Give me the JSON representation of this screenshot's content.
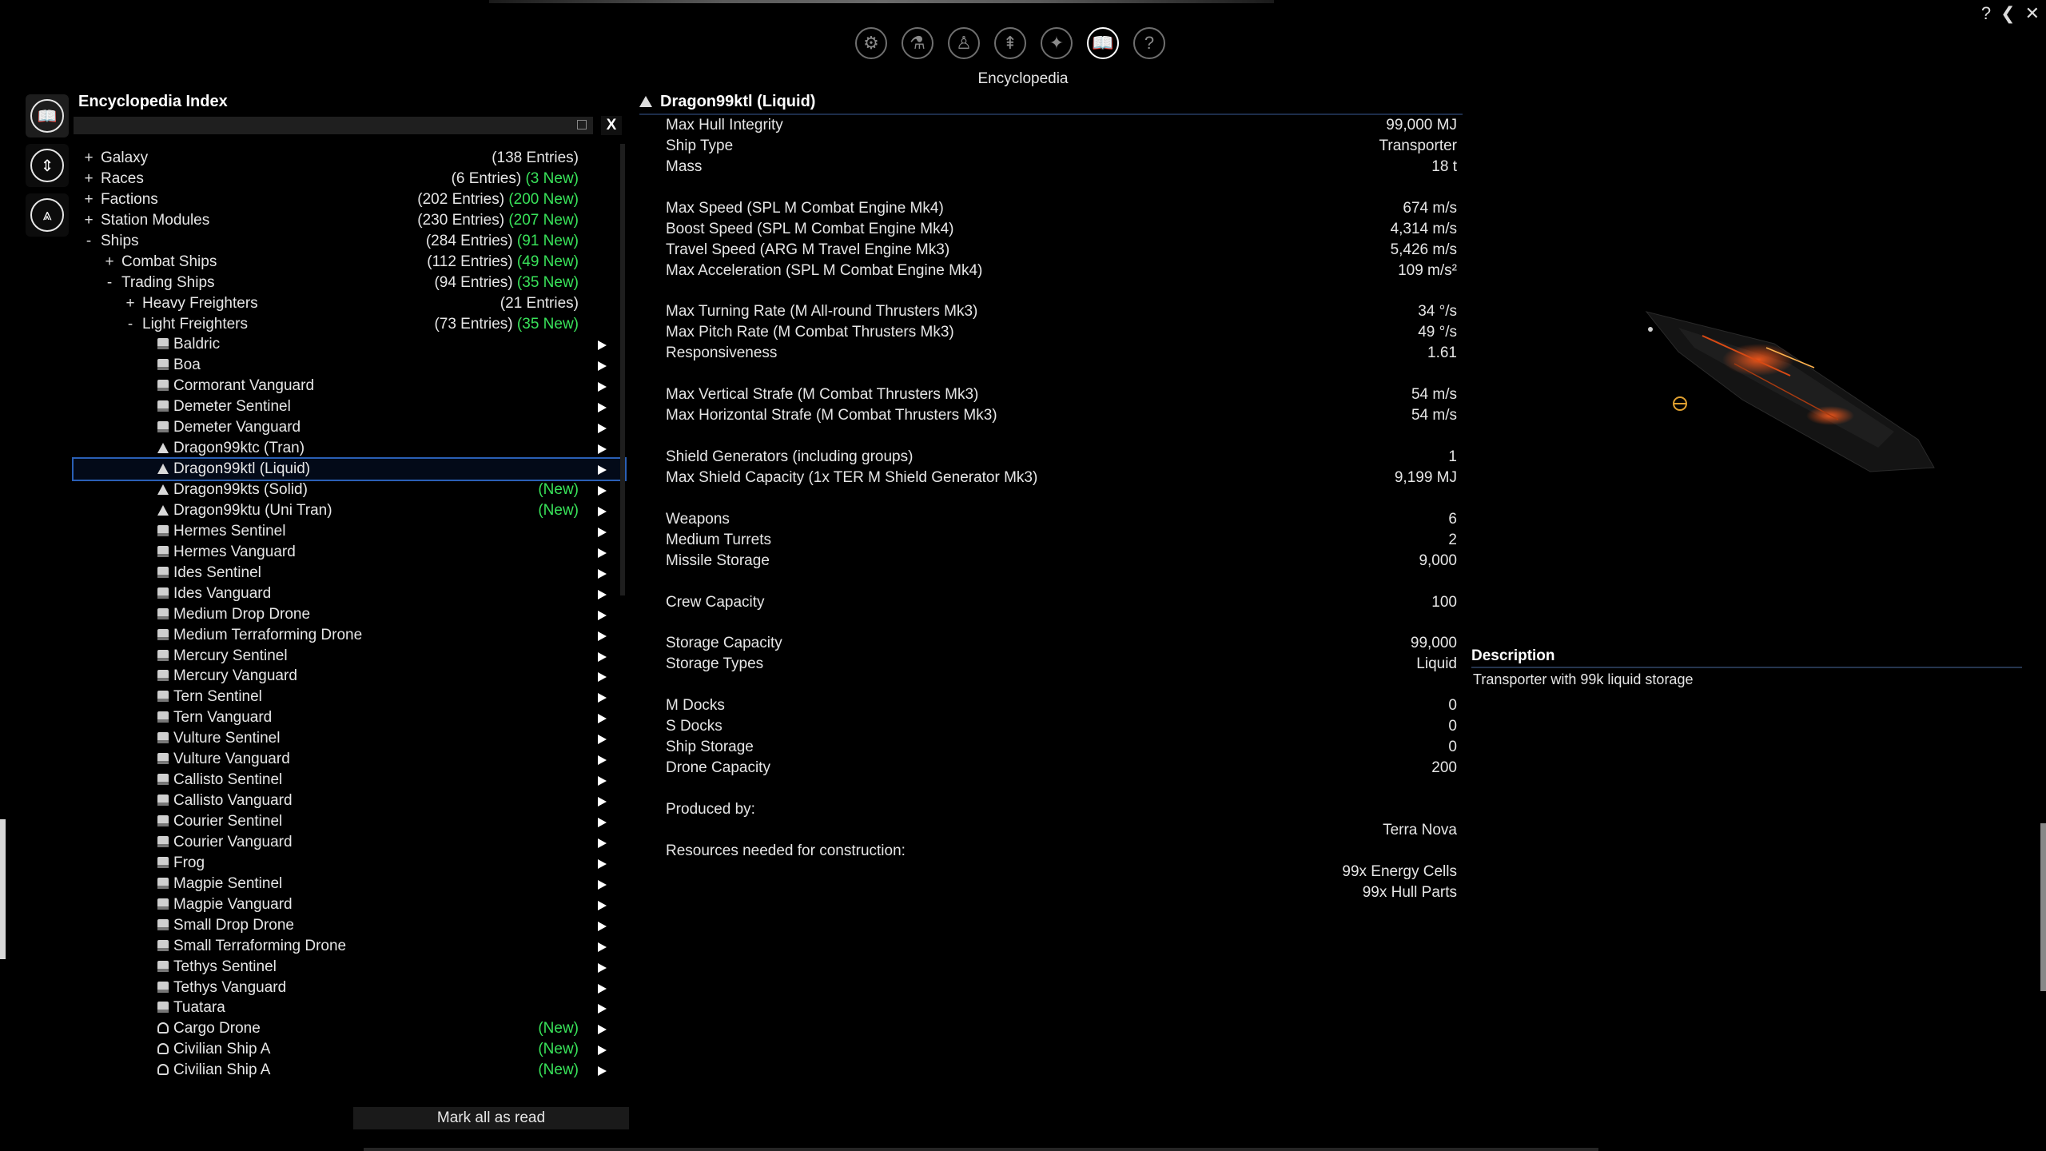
{
  "window_controls": {
    "help": "?",
    "back": "❮",
    "close": "✕"
  },
  "top_nav": {
    "label": "Encyclopedia",
    "buttons": [
      {
        "name": "options",
        "glyph": "⚙"
      },
      {
        "name": "flask",
        "glyph": "⚗"
      },
      {
        "name": "player",
        "glyph": "♙"
      },
      {
        "name": "ship",
        "glyph": "⇞"
      },
      {
        "name": "map",
        "glyph": "✦"
      },
      {
        "name": "encyclopedia",
        "glyph": "📖"
      },
      {
        "name": "help",
        "glyph": "?"
      }
    ]
  },
  "side_tabs": [
    {
      "name": "encyclopedia",
      "glyph": "📖"
    },
    {
      "name": "compass",
      "glyph": "⇕"
    },
    {
      "name": "fleet",
      "glyph": "⩓"
    }
  ],
  "index": {
    "title": "Encyclopedia Index",
    "search_placeholder": "",
    "clear_label": "X",
    "mark_all_label": "Mark all as read",
    "rows": [
      {
        "level": 0,
        "toggle": "+",
        "name": "Galaxy",
        "entries": "(138 Entries)",
        "new": ""
      },
      {
        "level": 0,
        "toggle": "+",
        "name": "Races",
        "entries": "(6 Entries)",
        "new": "(3 New)"
      },
      {
        "level": 0,
        "toggle": "+",
        "name": "Factions",
        "entries": "(202 Entries)",
        "new": "(200 New)"
      },
      {
        "level": 0,
        "toggle": "+",
        "name": "Station Modules",
        "entries": "(230 Entries)",
        "new": "(207 New)"
      },
      {
        "level": 0,
        "toggle": "-",
        "name": "Ships",
        "entries": "(284 Entries)",
        "new": "(91 New)"
      },
      {
        "level": 1,
        "toggle": "+",
        "name": "Combat Ships",
        "entries": "(112 Entries)",
        "new": "(49 New)"
      },
      {
        "level": 1,
        "toggle": "-",
        "name": "Trading Ships",
        "entries": "(94 Entries)",
        "new": "(35 New)"
      },
      {
        "level": 2,
        "toggle": "+",
        "name": "Heavy Freighters",
        "entries": "(21 Entries)",
        "new": ""
      },
      {
        "level": 2,
        "toggle": "-",
        "name": "Light Freighters",
        "entries": "(73 Entries)",
        "new": "(35 New)"
      },
      {
        "level": 3,
        "icon": "ship",
        "name": "Baldric",
        "new": ""
      },
      {
        "level": 3,
        "icon": "ship",
        "name": "Boa",
        "new": ""
      },
      {
        "level": 3,
        "icon": "ship",
        "name": "Cormorant Vanguard",
        "new": ""
      },
      {
        "level": 3,
        "icon": "ship",
        "name": "Demeter Sentinel",
        "new": ""
      },
      {
        "level": 3,
        "icon": "ship",
        "name": "Demeter Vanguard",
        "new": ""
      },
      {
        "level": 3,
        "icon": "tri",
        "name": "Dragon99ktc (Tran)",
        "new": ""
      },
      {
        "level": 3,
        "icon": "tri",
        "name": "Dragon99ktl (Liquid)",
        "new": "",
        "selected": true
      },
      {
        "level": 3,
        "icon": "tri",
        "name": "Dragon99kts (Solid)",
        "new": "(New)"
      },
      {
        "level": 3,
        "icon": "tri",
        "name": "Dragon99ktu (Uni Tran)",
        "new": "(New)"
      },
      {
        "level": 3,
        "icon": "ship",
        "name": "Hermes Sentinel",
        "new": ""
      },
      {
        "level": 3,
        "icon": "ship",
        "name": "Hermes Vanguard",
        "new": ""
      },
      {
        "level": 3,
        "icon": "ship",
        "name": "Ides Sentinel",
        "new": ""
      },
      {
        "level": 3,
        "icon": "ship",
        "name": "Ides Vanguard",
        "new": ""
      },
      {
        "level": 3,
        "icon": "ship",
        "name": "Medium Drop Drone",
        "new": ""
      },
      {
        "level": 3,
        "icon": "ship",
        "name": "Medium Terraforming Drone",
        "new": ""
      },
      {
        "level": 3,
        "icon": "ship",
        "name": "Mercury Sentinel",
        "new": ""
      },
      {
        "level": 3,
        "icon": "ship",
        "name": "Mercury Vanguard",
        "new": ""
      },
      {
        "level": 3,
        "icon": "ship",
        "name": "Tern Sentinel",
        "new": ""
      },
      {
        "level": 3,
        "icon": "ship",
        "name": "Tern Vanguard",
        "new": ""
      },
      {
        "level": 3,
        "icon": "ship",
        "name": "Vulture Sentinel",
        "new": ""
      },
      {
        "level": 3,
        "icon": "ship",
        "name": "Vulture Vanguard",
        "new": ""
      },
      {
        "level": 3,
        "icon": "ship",
        "name": "Callisto Sentinel",
        "new": ""
      },
      {
        "level": 3,
        "icon": "ship",
        "name": "Callisto Vanguard",
        "new": ""
      },
      {
        "level": 3,
        "icon": "ship",
        "name": "Courier Sentinel",
        "new": ""
      },
      {
        "level": 3,
        "icon": "ship",
        "name": "Courier Vanguard",
        "new": ""
      },
      {
        "level": 3,
        "icon": "ship",
        "name": "Frog",
        "new": ""
      },
      {
        "level": 3,
        "icon": "ship",
        "name": "Magpie Sentinel",
        "new": ""
      },
      {
        "level": 3,
        "icon": "ship",
        "name": "Magpie Vanguard",
        "new": ""
      },
      {
        "level": 3,
        "icon": "ship",
        "name": "Small Drop Drone",
        "new": ""
      },
      {
        "level": 3,
        "icon": "ship",
        "name": "Small Terraforming Drone",
        "new": ""
      },
      {
        "level": 3,
        "icon": "ship",
        "name": "Tethys Sentinel",
        "new": ""
      },
      {
        "level": 3,
        "icon": "ship",
        "name": "Tethys Vanguard",
        "new": ""
      },
      {
        "level": 3,
        "icon": "ship",
        "name": "Tuatara",
        "new": ""
      },
      {
        "level": 3,
        "icon": "drone",
        "name": "Cargo Drone",
        "new": "(New)"
      },
      {
        "level": 3,
        "icon": "drone",
        "name": "Civilian Ship A",
        "new": "(New)"
      },
      {
        "level": 3,
        "icon": "drone",
        "name": "Civilian Ship A",
        "new": "(New)"
      }
    ]
  },
  "detail": {
    "title": "Dragon99ktl (Liquid)",
    "stats": [
      {
        "label": "Max Hull Integrity",
        "value": "99,000 MJ"
      },
      {
        "label": "Ship Type",
        "value": "Transporter"
      },
      {
        "label": "Mass",
        "value": "18 t"
      },
      {
        "gap": true
      },
      {
        "label": "Max Speed (SPL M Combat Engine Mk4)",
        "value": "674 m/s"
      },
      {
        "label": "Boost Speed (SPL M Combat Engine Mk4)",
        "value": "4,314 m/s"
      },
      {
        "label": "Travel Speed (ARG M Travel Engine Mk3)",
        "value": "5,426 m/s"
      },
      {
        "label": "Max Acceleration (SPL M Combat Engine Mk4)",
        "value": "109 m/s²"
      },
      {
        "gap": true
      },
      {
        "label": "Max Turning Rate (M All-round Thrusters Mk3)",
        "value": "34 °/s"
      },
      {
        "label": "Max Pitch Rate (M Combat Thrusters Mk3)",
        "value": "49 °/s"
      },
      {
        "label": "Responsiveness",
        "value": "1.61"
      },
      {
        "gap": true
      },
      {
        "label": "Max Vertical Strafe (M Combat Thrusters Mk3)",
        "value": "54 m/s"
      },
      {
        "label": "Max Horizontal Strafe (M Combat Thrusters Mk3)",
        "value": "54 m/s"
      },
      {
        "gap": true
      },
      {
        "label": "Shield Generators (including groups)",
        "value": "1"
      },
      {
        "label": "Max Shield Capacity (1x TER M Shield Generator Mk3)",
        "value": "9,199 MJ"
      },
      {
        "gap": true
      },
      {
        "label": "Weapons",
        "value": "6"
      },
      {
        "label": "Medium Turrets",
        "value": "2"
      },
      {
        "label": "Missile Storage",
        "value": "9,000"
      },
      {
        "gap": true
      },
      {
        "label": "Crew Capacity",
        "value": "100"
      },
      {
        "gap": true
      },
      {
        "label": "Storage Capacity",
        "value": "99,000"
      },
      {
        "label": "Storage Types",
        "value": "Liquid"
      },
      {
        "gap": true
      },
      {
        "label": "M Docks",
        "value": "0"
      },
      {
        "label": "S Docks",
        "value": "0"
      },
      {
        "label": "Ship Storage",
        "value": "0"
      },
      {
        "label": "Drone Capacity",
        "value": "200"
      },
      {
        "gap": true
      },
      {
        "label": "Produced by:",
        "value": ""
      },
      {
        "label": "",
        "value": "Terra Nova"
      },
      {
        "label": "Resources needed for construction:",
        "value": ""
      },
      {
        "label": "",
        "value": "99x Energy Cells"
      },
      {
        "label": "",
        "value": "99x Hull Parts"
      }
    ],
    "description_title": "Description",
    "description_text": "Transporter with 99k liquid storage"
  }
}
